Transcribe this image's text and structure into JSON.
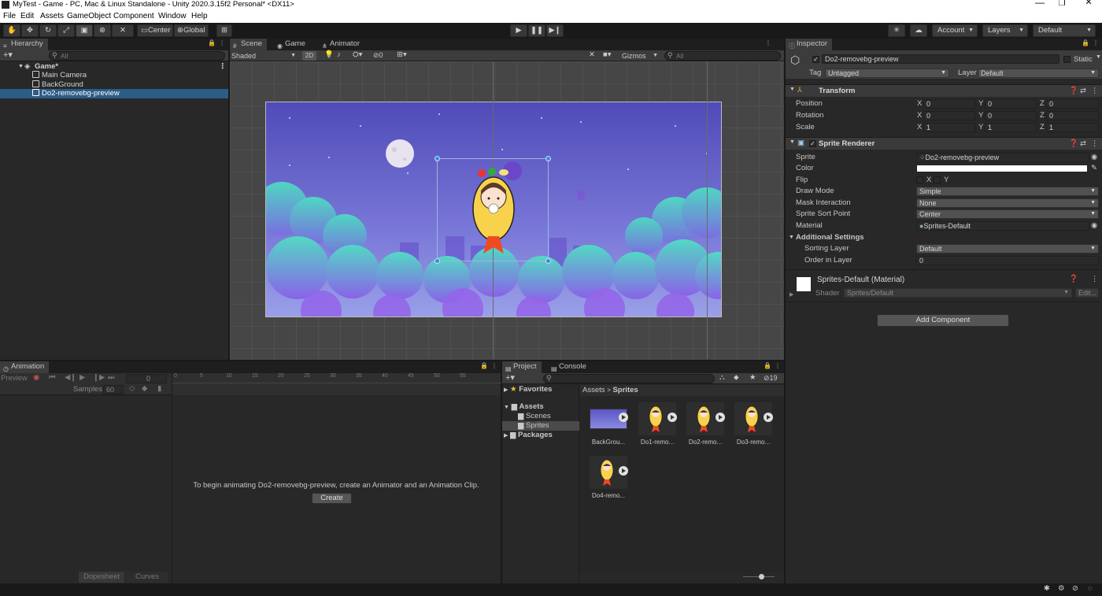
{
  "window": {
    "title": "MyTest - Game - PC, Mac & Linux Standalone - Unity 2020.3.15f2 Personal* <DX11>",
    "minimize": "—",
    "maximize": "❐",
    "close": "✕"
  },
  "menu": [
    "File",
    "Edit",
    "Assets",
    "GameObject",
    "Component",
    "Window",
    "Help"
  ],
  "toolbar": {
    "pivot": "Center",
    "space": "Global",
    "account": "Account",
    "layers": "Layers",
    "layout": "Default"
  },
  "hierarchy": {
    "tab": "Hierarchy",
    "search_placeholder": "All",
    "scene": "Game*",
    "items": [
      "Main Camera",
      "BackGround",
      "Do2-removebg-preview"
    ]
  },
  "scene_panel": {
    "tabs": [
      "Scene",
      "Game",
      "Animator"
    ],
    "shading": "Shaded",
    "mode_2d": "2D",
    "hidden_count": "0",
    "gizmos": "Gizmos",
    "search_placeholder": "All"
  },
  "inspector": {
    "tab": "Inspector",
    "object_name": "Do2-removebg-preview",
    "static_label": "Static",
    "tag_label": "Tag",
    "tag_value": "Untagged",
    "layer_label": "Layer",
    "layer_value": "Default",
    "transform": {
      "title": "Transform",
      "position_label": "Position",
      "rotation_label": "Rotation",
      "scale_label": "Scale",
      "position": [
        "0",
        "0",
        "0"
      ],
      "rotation": [
        "0",
        "0",
        "0"
      ],
      "scale": [
        "1",
        "1",
        "1"
      ]
    },
    "sprite_renderer": {
      "title": "Sprite Renderer",
      "sprite_label": "Sprite",
      "sprite_value": "Do2-removebg-preview",
      "color_label": "Color",
      "flip_label": "Flip",
      "flip_x": "X",
      "flip_y": "Y",
      "draw_mode_label": "Draw Mode",
      "draw_mode_value": "Simple",
      "mask_label": "Mask Interaction",
      "mask_value": "None",
      "sort_point_label": "Sprite Sort Point",
      "sort_point_value": "Center",
      "material_label": "Material",
      "material_value": "Sprites-Default",
      "additional_label": "Additional Settings",
      "sorting_layer_label": "Sorting Layer",
      "sorting_layer_value": "Default",
      "order_label": "Order in Layer",
      "order_value": "0"
    },
    "material": {
      "title": "Sprites-Default (Material)",
      "shader_label": "Shader",
      "shader_value": "Sprites/Default",
      "edit_label": "Edit..."
    },
    "add_component": "Add Component",
    "colors": {
      "sprite_color": "#ffffff"
    }
  },
  "animation": {
    "tab": "Animation",
    "preview": "Preview",
    "frame": "0",
    "samples_label": "Samples",
    "samples_value": "60",
    "message": "To begin animating Do2-removebg-preview, create an Animator and an Animation Clip.",
    "create": "Create",
    "dopesheet": "Dopesheet",
    "curves": "Curves",
    "ruler": [
      "0",
      "5",
      "10",
      "15",
      "20",
      "25",
      "30",
      "35",
      "40",
      "45",
      "50",
      "55"
    ]
  },
  "project": {
    "tabs": [
      "Project",
      "Console"
    ],
    "hidden_count": "19",
    "tree": {
      "favorites": "Favorites",
      "assets": "Assets",
      "scenes": "Scenes",
      "sprites": "Sprites",
      "packages": "Packages"
    },
    "breadcrumb": [
      "Assets",
      "Sprites"
    ],
    "files": [
      "BackGrou...",
      "Do1-remo...",
      "Do2-remo...",
      "Do3-remo...",
      "Do4-remo..."
    ]
  }
}
